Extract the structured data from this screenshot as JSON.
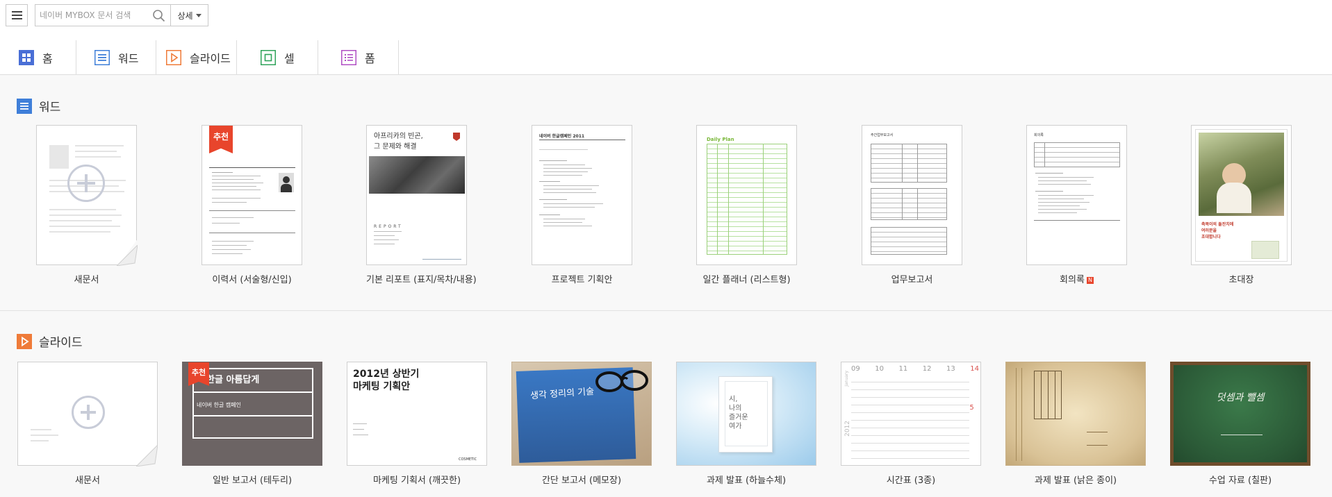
{
  "header": {
    "search_placeholder": "네이버 MYBOX 문서 검색",
    "detail_label": "상세"
  },
  "tabs": [
    {
      "label": "홈",
      "color": "#4a72d9"
    },
    {
      "label": "워드",
      "color": "#3f7fd9"
    },
    {
      "label": "슬라이드",
      "color": "#ef7b39"
    },
    {
      "label": "셀",
      "color": "#2fa35a"
    },
    {
      "label": "폼",
      "color": "#b04fc4"
    }
  ],
  "word_section": {
    "title": "워드",
    "templates": [
      {
        "label": "새문서"
      },
      {
        "label": "이력서 (서술형/신입)",
        "badge": "추천"
      },
      {
        "label": "기본 리포트 (표지/목차/내용)",
        "thumb_title": "아프리카의 빈곤,\n그 문제와 해결",
        "thumb_sub": "REPORT"
      },
      {
        "label": "프로젝트 기획안",
        "thumb_title": "네이버 한글캠페인 2011"
      },
      {
        "label": "일간 플래너 (리스트형)",
        "thumb_title": "Daily Plan"
      },
      {
        "label": "업무보고서",
        "thumb_title": "주간업무보고서"
      },
      {
        "label": "회의록",
        "new_mark": "N",
        "thumb_title": "회의록"
      },
      {
        "label": "초대장",
        "thumb_title": "축복이의 돌잔치에\n여러분을\n초대합니다"
      }
    ]
  },
  "slide_section": {
    "title": "슬라이드",
    "templates": [
      {
        "label": "새문서"
      },
      {
        "label": "일반 보고서 (테두리)",
        "badge": "추천",
        "thumb_title": "한글 아름답게",
        "thumb_sub": "네이버 한글 캠페인"
      },
      {
        "label": "마케팅 기획서 (깨끗한)",
        "thumb_title": "2012년 상반기\n마케팅 기획안",
        "thumb_sub": "COSMETIC"
      },
      {
        "label": "간단 보고서 (메모장)",
        "thumb_title": "생각 정리의 기술"
      },
      {
        "label": "과제 발표 (하늘수체)",
        "thumb_title": "시,\n나의\n즐거운\n여가"
      },
      {
        "label": "시간표 (3종)",
        "thumb_days": [
          "09",
          "10",
          "11",
          "12",
          "13",
          "14"
        ],
        "thumb_year": "2012",
        "thumb_month": "January",
        "thumb_side": "15"
      },
      {
        "label": "과제 발표 (낡은 종이)"
      },
      {
        "label": "수업 자료 (칠판)",
        "thumb_title": "덧셈과 뺄셈"
      }
    ]
  }
}
